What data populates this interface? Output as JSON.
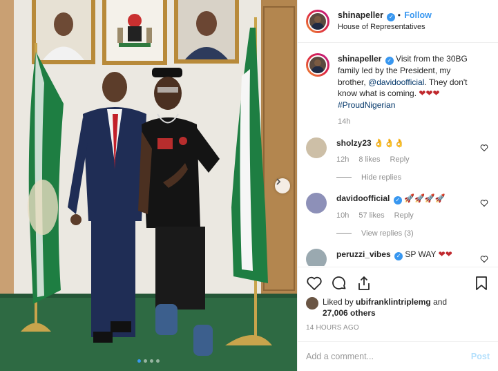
{
  "post": {
    "username": "shinapeller",
    "follow_label": "Follow",
    "location": "House of Representatives",
    "verified_glyph": "✓"
  },
  "caption": {
    "username": "shinapeller",
    "text_before": "Visit from the 30BG family led by the President, my brother,",
    "mention": "@davidoofficial",
    "text_after": ". They don't know what is coming.",
    "hearts": "❤❤❤",
    "hashtag": "#ProudNigerian",
    "time": "14h"
  },
  "comments": [
    {
      "username": "sholzy23",
      "text": "👌👌👌",
      "time": "12h",
      "likes": "8 likes",
      "reply_label": "Reply",
      "replies_label": "Hide replies",
      "verified": false,
      "avatar_color": "#cdbfa7"
    },
    {
      "username": "davidoofficial",
      "text": "🚀🚀🚀🚀",
      "time": "10h",
      "likes": "57 likes",
      "reply_label": "Reply",
      "replies_label": "View replies (3)",
      "verified": true,
      "avatar_color": "#8d90b8"
    },
    {
      "username": "peruzzi_vibes",
      "text": "SP WAY",
      "hearts": "❤❤",
      "verified": true,
      "avatar_color": "#9aa9b0"
    }
  ],
  "likes": {
    "prefix": "Liked by",
    "user": "ubifranklintriplemg",
    "conj": "and",
    "count": "27,006 others"
  },
  "timestamp": "14 HOURS AGO",
  "add_comment": {
    "placeholder": "Add a comment...",
    "post_label": "Post"
  },
  "carousel": {
    "count": 4,
    "active_index": 0
  },
  "icons": [
    "heart-icon",
    "comment-icon",
    "share-icon",
    "bookmark-icon",
    "chevron-right-icon"
  ],
  "colors": {
    "accent": "#3897f0",
    "text": "#262626",
    "muted": "#8e8e8e",
    "heart": "#c0282d",
    "post_disabled": "#b2dffc"
  }
}
